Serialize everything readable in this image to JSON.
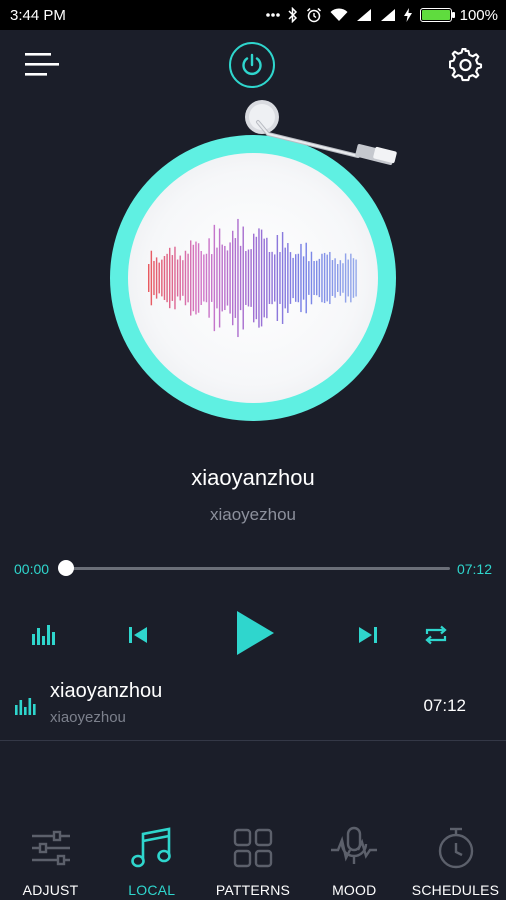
{
  "status_bar": {
    "time": "3:44 PM",
    "battery": "100%",
    "battery_level": 1.0
  },
  "colors": {
    "accent": "#2fd6cd",
    "background": "#1b1e29",
    "disc_ring": "#5ff0e2"
  },
  "header": {
    "menu_icon": "menu-icon",
    "power_icon": "power-icon",
    "settings_icon": "gear-icon"
  },
  "now_playing": {
    "title": "xiaoyanzhou",
    "artist": "xiaoyezhou"
  },
  "progress": {
    "current": "00:00",
    "total": "07:12",
    "fraction": 0.0
  },
  "controls": {
    "equalizer": "equalizer-icon",
    "previous": "skip-previous-icon",
    "play": "play-icon",
    "next": "skip-next-icon",
    "repeat": "repeat-icon"
  },
  "playlist": [
    {
      "title": "xiaoyanzhou",
      "artist": "xiaoyezhou",
      "duration": "07:12"
    }
  ],
  "bottom_nav": [
    {
      "label": "ADJUST",
      "icon": "sliders-icon",
      "active": false
    },
    {
      "label": "LOCAL",
      "icon": "music-note-icon",
      "active": true
    },
    {
      "label": "PATTERNS",
      "icon": "grid-icon",
      "active": false
    },
    {
      "label": "MOOD",
      "icon": "microphone-icon",
      "active": false
    },
    {
      "label": "SCHEDULES",
      "icon": "stopwatch-icon",
      "active": false
    }
  ]
}
